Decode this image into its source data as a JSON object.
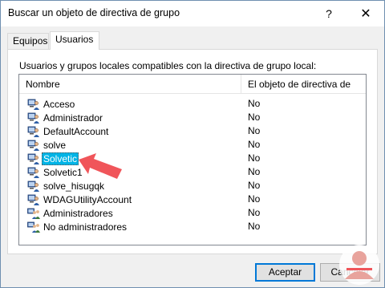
{
  "window": {
    "title": "Buscar un objeto de directiva de grupo",
    "help_label": "?",
    "close_label": "✕"
  },
  "tabs": [
    {
      "label": "Equipos",
      "active": false
    },
    {
      "label": "Usuarios",
      "active": true
    }
  ],
  "panel": {
    "label": "Usuarios y grupos locales compatibles con la directiva de grupo local:",
    "columns": [
      "Nombre",
      "El objeto de directiva de ..."
    ],
    "rows": [
      {
        "name": "Acceso",
        "value": "No",
        "icon": "user-icon"
      },
      {
        "name": "Administrador",
        "value": "No",
        "icon": "user-icon"
      },
      {
        "name": "DefaultAccount",
        "value": "No",
        "icon": "user-icon"
      },
      {
        "name": "solve",
        "value": "No",
        "icon": "user-icon"
      },
      {
        "name": "Solvetic",
        "value": "No",
        "icon": "user-icon",
        "selected": true
      },
      {
        "name": "Solvetic1",
        "value": "No",
        "icon": "user-icon"
      },
      {
        "name": "solve_hisugqk",
        "value": "No",
        "icon": "user-icon"
      },
      {
        "name": "WDAGUtilityAccount",
        "value": "No",
        "icon": "user-icon"
      },
      {
        "name": "Administradores",
        "value": "No",
        "icon": "group-icon"
      },
      {
        "name": "No administradores",
        "value": "No",
        "icon": "group-icon"
      }
    ]
  },
  "buttons": {
    "ok": "Aceptar",
    "cancel": "Cancelar"
  },
  "colors": {
    "selection": "#00b4e6",
    "arrow": "#f0555a",
    "ok_border": "#0078d7"
  }
}
